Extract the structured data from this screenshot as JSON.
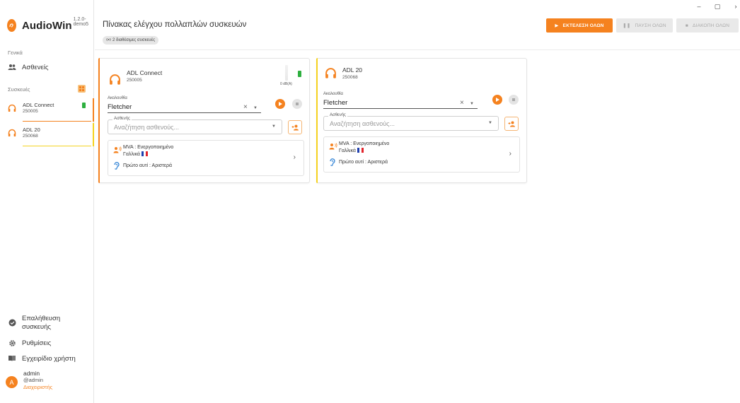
{
  "window": {
    "minimize": "–",
    "restore": "▢",
    "close": "›"
  },
  "brand": {
    "name": "AudioWin",
    "version": "1.2.0-demo5"
  },
  "sidebar": {
    "general_label": "Γενικά",
    "patients_label": "Ασθενείς",
    "devices_label": "Συσκευές",
    "devices": [
      {
        "name": "ADL Connect",
        "serial": "250005",
        "accent": "#f5821f",
        "battery": true
      },
      {
        "name": "ADL 20",
        "serial": "250068",
        "accent": "#f5d21f",
        "battery": false
      }
    ],
    "bottom": [
      {
        "label": "Επαλήθευση συσκευής"
      },
      {
        "label": "Ρυθμίσεις"
      },
      {
        "label": "Εγχειρίδιο χρήστη"
      }
    ],
    "user": {
      "initial": "A",
      "name": "admin",
      "handle": "@admin",
      "role": "Διαχειριστής"
    }
  },
  "header": {
    "title": "Πίνακας ελέγχου πολλαπλών συσκευών",
    "chip": "2 διαθέσιμες συσκευές",
    "buttons": {
      "run_all": "ΕΚΤΕΛΕΣΗ ΟΛΩΝ",
      "pause_all": "ΠΑΥΣΗ ΟΛΩΝ",
      "stop_all": "ΔΙΑΚΟΠΗ ΟΛΩΝ"
    }
  },
  "cards": [
    {
      "name": "ADL Connect",
      "serial": "250005",
      "accent": "#f5821f",
      "level": "0 dB(A)",
      "sequence_label": "Ακολουθία",
      "sequence_value": "Fletcher",
      "patient_label": "Ασθενής",
      "patient_placeholder": "Αναζήτηση ασθενούς...",
      "mva": "MVA : Ενεργοποιημένο",
      "language": "Γαλλικά",
      "first_ear": "Πρώτο αυτί : Αριστερά"
    },
    {
      "name": "ADL 20",
      "serial": "250068",
      "accent": "#f5d21f",
      "sequence_label": "Ακολουθία",
      "sequence_value": "Fletcher",
      "patient_label": "Ασθενής",
      "patient_placeholder": "Αναζήτηση ασθενούς...",
      "mva": "MVA : Ενεργοποιημένο",
      "language": "Γαλλικά",
      "first_ear": "Πρώτο αυτί : Αριστερά"
    }
  ],
  "colors": {
    "accent": "#f5821f",
    "battery": "#2eaf3f",
    "yellow_accent": "#f5d21f"
  }
}
